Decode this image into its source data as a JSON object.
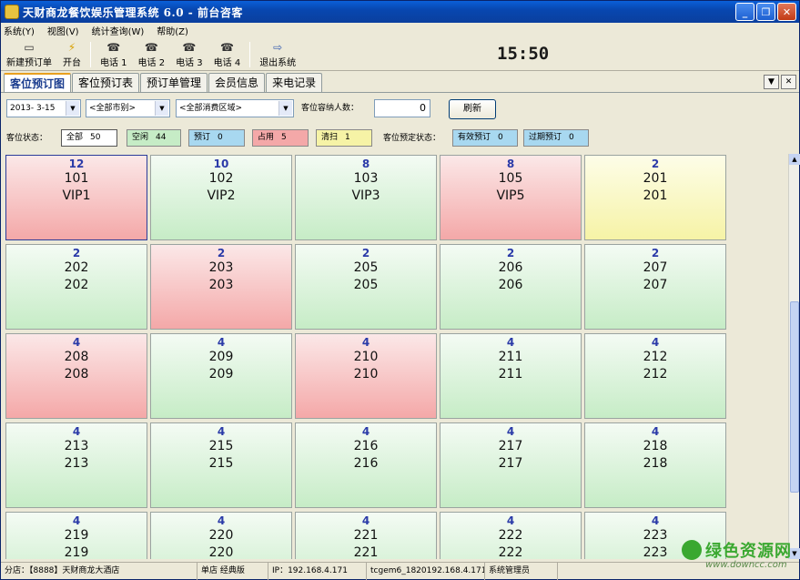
{
  "window": {
    "title": "天财商龙餐饮娱乐管理系统 6.0 - 前台咨客"
  },
  "menu": [
    "系统(Y)",
    "视图(V)",
    "统计查询(W)",
    "帮助(Z)"
  ],
  "toolbar": {
    "new_order": "新建预订单",
    "open_table": "开台",
    "phone1": "电话 1",
    "phone2": "电话 2",
    "phone3": "电话 3",
    "phone4": "电话 4",
    "exit": "退出系统"
  },
  "clock": "15:50",
  "tabs": [
    "客位预订图",
    "客位预订表",
    "预订单管理",
    "会员信息",
    "来电记录"
  ],
  "filters": {
    "date": "2013- 3-15",
    "market": "<全部市别>",
    "area": "<全部消费区域>",
    "capacity_label": "客位容纳人数：",
    "capacity_value": "0",
    "refresh": "刷新"
  },
  "status": {
    "label": "客位状态：",
    "all": {
      "label": "全部",
      "count": "50"
    },
    "free": {
      "label": "空闲",
      "count": "44"
    },
    "reserved": {
      "label": "预订",
      "count": "0"
    },
    "occupied": {
      "label": "占用",
      "count": "5"
    },
    "cleaning": {
      "label": "清扫",
      "count": "1"
    },
    "booking_label": "客位预定状态：",
    "valid": {
      "label": "有效预订",
      "count": "0"
    },
    "expired": {
      "label": "过期预订",
      "count": "0"
    }
  },
  "colors": {
    "free": "#c6ecc6",
    "occupied": "#f4a8a8",
    "cleaning": "#f6f3a6",
    "reserved": "#a8d8f0",
    "capacity_text": "#2a3aa8"
  },
  "rooms": [
    {
      "cap": "12",
      "no": "101",
      "name": "VIP1",
      "state": "red"
    },
    {
      "cap": "10",
      "no": "102",
      "name": "VIP2",
      "state": "green"
    },
    {
      "cap": "8",
      "no": "103",
      "name": "VIP3",
      "state": "green"
    },
    {
      "cap": "8",
      "no": "105",
      "name": "VIP5",
      "state": "red"
    },
    {
      "cap": "2",
      "no": "201",
      "name": "201",
      "state": "yellow"
    },
    {
      "cap": "2",
      "no": "202",
      "name": "202",
      "state": "green"
    },
    {
      "cap": "2",
      "no": "203",
      "name": "203",
      "state": "red"
    },
    {
      "cap": "2",
      "no": "205",
      "name": "205",
      "state": "green"
    },
    {
      "cap": "2",
      "no": "206",
      "name": "206",
      "state": "green"
    },
    {
      "cap": "2",
      "no": "207",
      "name": "207",
      "state": "green"
    },
    {
      "cap": "4",
      "no": "208",
      "name": "208",
      "state": "red"
    },
    {
      "cap": "4",
      "no": "209",
      "name": "209",
      "state": "green"
    },
    {
      "cap": "4",
      "no": "210",
      "name": "210",
      "state": "red"
    },
    {
      "cap": "4",
      "no": "211",
      "name": "211",
      "state": "green"
    },
    {
      "cap": "4",
      "no": "212",
      "name": "212",
      "state": "green"
    },
    {
      "cap": "4",
      "no": "213",
      "name": "213",
      "state": "green"
    },
    {
      "cap": "4",
      "no": "215",
      "name": "215",
      "state": "green"
    },
    {
      "cap": "4",
      "no": "216",
      "name": "216",
      "state": "green"
    },
    {
      "cap": "4",
      "no": "217",
      "name": "217",
      "state": "green"
    },
    {
      "cap": "4",
      "no": "218",
      "name": "218",
      "state": "green"
    },
    {
      "cap": "4",
      "no": "219",
      "name": "219",
      "state": "green"
    },
    {
      "cap": "4",
      "no": "220",
      "name": "220",
      "state": "green"
    },
    {
      "cap": "4",
      "no": "221",
      "name": "221",
      "state": "green"
    },
    {
      "cap": "4",
      "no": "222",
      "name": "222",
      "state": "green"
    },
    {
      "cap": "4",
      "no": "223",
      "name": "223",
      "state": "green"
    }
  ],
  "statusbar": {
    "branch": "分店：【8888】天财商龙大酒店",
    "mode": "单店  经典版",
    "ip": "IP：192.168.4.171",
    "host": "tcgem6_1820192.168.4.171",
    "user": "系统管理员"
  },
  "watermark": {
    "text": "绿色资源网",
    "url": "www.downcc.com"
  }
}
